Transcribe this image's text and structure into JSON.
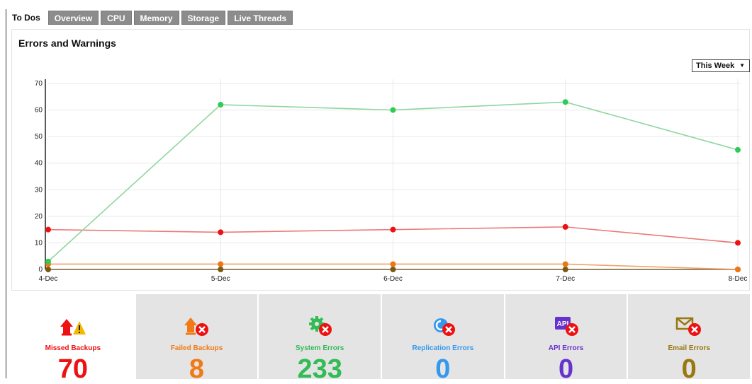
{
  "tabs": [
    {
      "label": "To Dos",
      "active": true
    },
    {
      "label": "Overview",
      "active": false
    },
    {
      "label": "CPU",
      "active": false
    },
    {
      "label": "Memory",
      "active": false
    },
    {
      "label": "Storage",
      "active": false
    },
    {
      "label": "Live Threads",
      "active": false
    }
  ],
  "panel": {
    "title": "Errors and Warnings",
    "range_select": {
      "value": "This Week",
      "caret": "▼"
    }
  },
  "chart_data": {
    "type": "line",
    "categories": [
      "4-Dec",
      "5-Dec",
      "6-Dec",
      "7-Dec",
      "8-Dec"
    ],
    "ylim": [
      0,
      70
    ],
    "yticks": [
      0,
      10,
      20,
      30,
      40,
      50,
      60,
      70
    ],
    "grid": true,
    "series": [
      {
        "color": "#2ecc55",
        "line_color": "#8fd6a0",
        "values": [
          3,
          62,
          60,
          63,
          45
        ]
      },
      {
        "color": "#ee1111",
        "line_color": "#ea7a7a",
        "values": [
          15,
          14,
          15,
          16,
          10
        ]
      },
      {
        "color": "#ee7711",
        "line_color": "#f0a36a",
        "values": [
          2,
          2,
          2,
          2,
          0
        ]
      },
      {
        "color": "#7a5a10",
        "line_color": "#9a8050",
        "values": [
          0,
          0,
          0,
          0,
          0
        ]
      }
    ]
  },
  "stats": [
    {
      "label": "Missed Backups",
      "count": "70",
      "color": "#ee1111",
      "icon": "missed-backup-icon"
    },
    {
      "label": "Failed Backups",
      "count": "8",
      "color": "#f07a16",
      "icon": "failed-backup-icon"
    },
    {
      "label": "System Errors",
      "count": "233",
      "color": "#33bb55",
      "icon": "system-error-icon"
    },
    {
      "label": "Replication Errors",
      "count": "0",
      "color": "#3399ee",
      "icon": "replication-error-icon"
    },
    {
      "label": "API Errors",
      "count": "0",
      "color": "#6633cc",
      "icon": "api-error-icon"
    },
    {
      "label": "Email Errors",
      "count": "0",
      "color": "#997711",
      "icon": "email-error-icon"
    }
  ],
  "icon_text": {
    "api": "API"
  }
}
